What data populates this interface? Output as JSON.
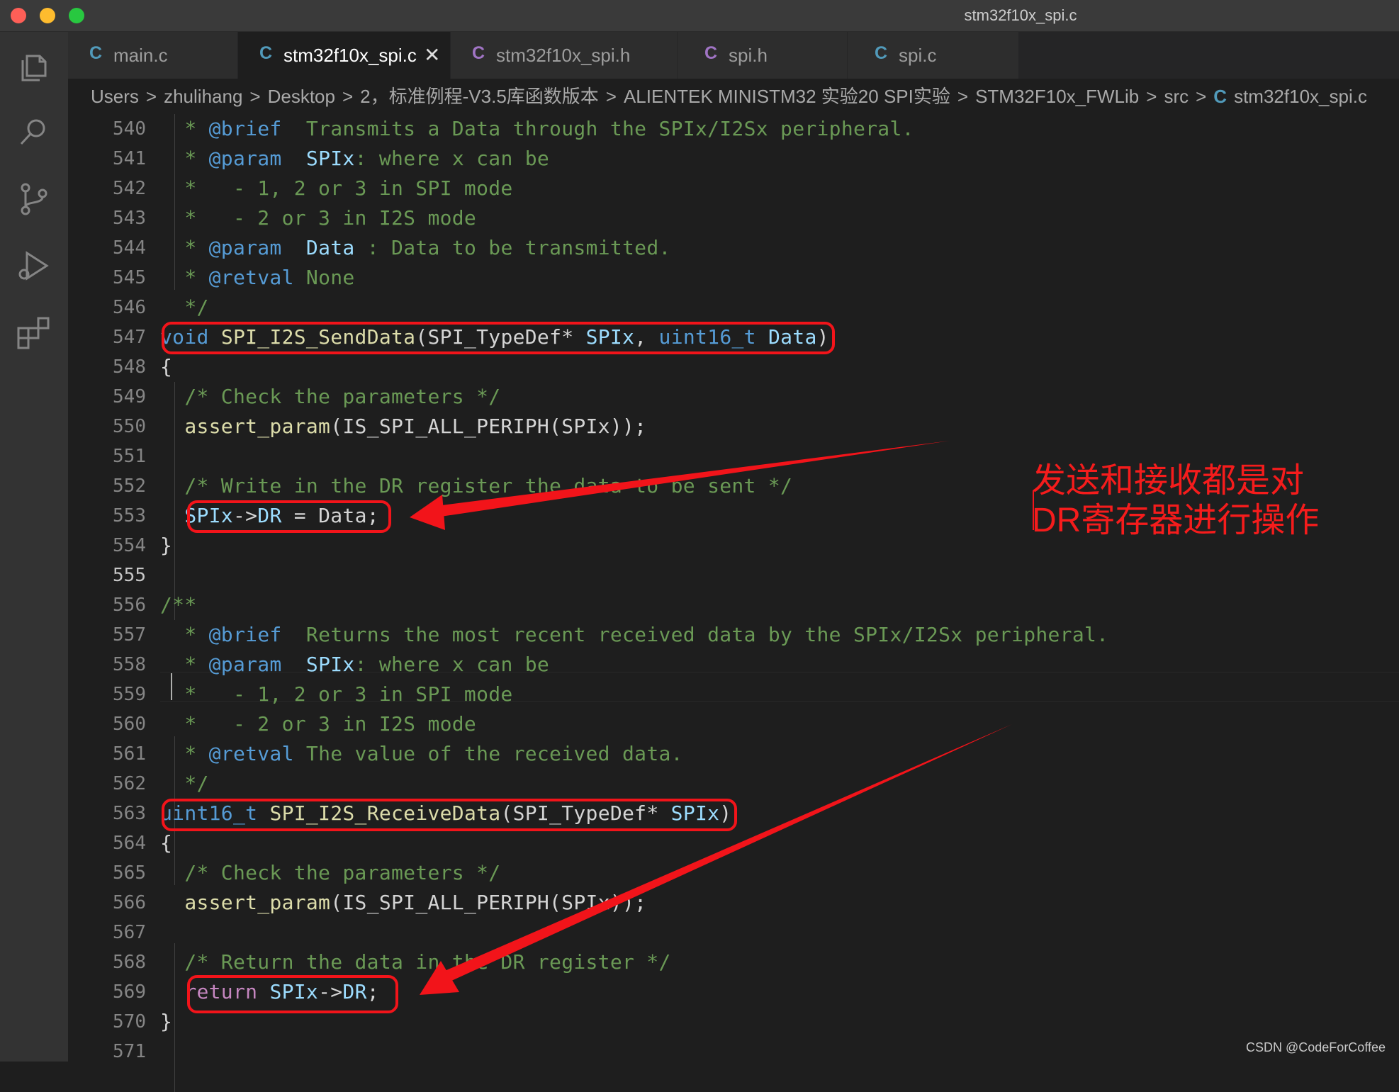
{
  "window": {
    "title": "stm32f10x_spi.c"
  },
  "activity_bar": [
    "explorer-icon",
    "search-icon",
    "source-control-icon",
    "run-debug-icon",
    "extensions-icon"
  ],
  "tabs": [
    {
      "icon": "C",
      "label": "main.c",
      "icon_color": "#519aba",
      "active": false
    },
    {
      "icon": "C",
      "label": "stm32f10x_spi.c",
      "icon_color": "#519aba",
      "active": true,
      "close": "✕"
    },
    {
      "icon": "C",
      "label": "stm32f10x_spi.h",
      "icon_color": "#a074c4",
      "active": false
    },
    {
      "icon": "C",
      "label": "spi.h",
      "icon_color": "#a074c4",
      "active": false
    },
    {
      "icon": "C",
      "label": "spi.c",
      "icon_color": "#519aba",
      "active": false
    }
  ],
  "breadcrumb": {
    "items": [
      "Users",
      "zhulihang",
      "Desktop",
      "2，标准例程-V3.5库函数版本",
      "ALIENTEK MINISTM32 实验20 SPI实验",
      "STM32F10x_FWLib",
      "src"
    ],
    "separator": ">",
    "file_icon": "C",
    "file": "stm32f10x_spi.c"
  },
  "code": {
    "line_numbers": [
      "540",
      "541",
      "542",
      "543",
      "544",
      "545",
      "546",
      "547",
      "548",
      "549",
      "550",
      "551",
      "552",
      "553",
      "554",
      "555",
      "556",
      "557",
      "558",
      "559",
      "560",
      "561",
      "562",
      "563",
      "564",
      "565",
      "566",
      "567",
      "568",
      "569",
      "570",
      "571"
    ],
    "current_line": "555",
    "lines": {
      "l540": {
        "a": "  * ",
        "b": "@brief",
        "c": "  Transmits a Data through the SPIx/I2Sx peripheral."
      },
      "l541": {
        "a": "  * ",
        "b": "@param",
        "c": "  ",
        "d": "SPIx",
        "e": ": where x can be"
      },
      "l542": {
        "a": "  *   - 1, 2 or 3 in SPI mode"
      },
      "l543": {
        "a": "  *   - 2 or 3 in I2S mode"
      },
      "l544": {
        "a": "  * ",
        "b": "@param",
        "c": "  ",
        "d": "Data",
        "e": " : Data to be transmitted."
      },
      "l545": {
        "a": "  * ",
        "b": "@retval",
        "c": " None"
      },
      "l546": {
        "a": "  */"
      },
      "l547": {
        "kw": "void",
        "sp1": " ",
        "fn": "SPI_I2S_SendData",
        "p1": "(SPI_TypeDef* ",
        "a1": "SPIx",
        "p2": ", ",
        "ty": "uint16_t",
        "sp2": " ",
        "a2": "Data",
        "p3": ")"
      },
      "l548": {
        "a": "{"
      },
      "l549": {
        "a": "  /* Check the parameters */"
      },
      "l550": {
        "a": "  ",
        "fn": "assert_param",
        "b": "(IS_SPI_ALL_PERIPH(SPIx));"
      },
      "l552": {
        "a": "  /* Write in the DR register the data to be sent */"
      },
      "l553": {
        "ind": "  ",
        "v": "SPIx",
        "ar": "->",
        "m": "DR",
        "rest": " = Data;"
      },
      "l554": {
        "a": "}"
      },
      "l556": {
        "a": "/**"
      },
      "l557": {
        "a": "  * ",
        "b": "@brief",
        "c": "  Returns the most recent received data by the SPIx/I2Sx peripheral."
      },
      "l558": {
        "a": "  * ",
        "b": "@param",
        "c": "  ",
        "d": "SPIx",
        "e": ": where x can be"
      },
      "l559": {
        "a": "  *   - 1, 2 or 3 in SPI mode"
      },
      "l560": {
        "a": "  *   - 2 or 3 in I2S mode"
      },
      "l561": {
        "a": "  * ",
        "b": "@retval",
        "c": " The value of the received data."
      },
      "l562": {
        "a": "  */"
      },
      "l563": {
        "ty": "uint16_t",
        "sp1": " ",
        "fn": "SPI_I2S_ReceiveData",
        "p1": "(SPI_TypeDef* ",
        "a1": "SPIx",
        "p2": ")"
      },
      "l564": {
        "a": "{"
      },
      "l565": {
        "a": "  /* Check the parameters */"
      },
      "l566": {
        "a": "  ",
        "fn": "assert_param",
        "b": "(IS_SPI_ALL_PERIPH(SPIx));"
      },
      "l568": {
        "a": "  /* Return the data in the DR register */"
      },
      "l569": {
        "ind": "  ",
        "kw": "return",
        "sp": " ",
        "v": "SPIx",
        "ar": "->",
        "m": "DR",
        "rest": ";"
      },
      "l570": {
        "a": "}"
      }
    }
  },
  "annotation": {
    "line1": "发送和接收都是对",
    "line2": "DR寄存器进行操作",
    "color": "#f2141a"
  },
  "watermark": "CSDN @CodeForCoffee"
}
